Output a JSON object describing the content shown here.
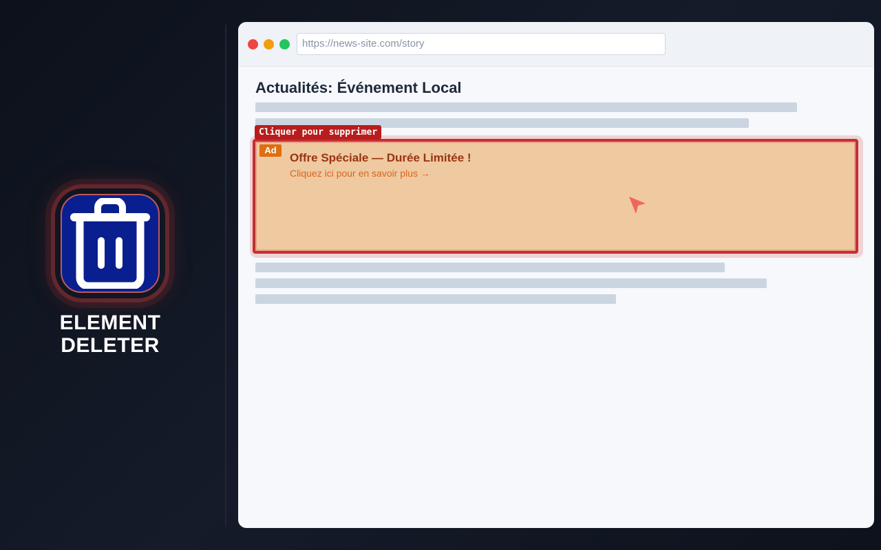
{
  "brand": {
    "name_line1": "ELEMENT",
    "name_line2": "DELETER",
    "icon": "trash-icon",
    "icon_bg_color": "#0a1f8f"
  },
  "browser": {
    "url": "https://news-site.com/story",
    "controls": [
      "close-dot",
      "minimize-dot",
      "maximize-dot"
    ]
  },
  "page": {
    "title": "Actualités: Événement Local"
  },
  "selector": {
    "tooltip": "Cliquer pour supprimer",
    "highlight_color": "#c43030"
  },
  "ad": {
    "badge": "Ad",
    "title": "Offre Spéciale — Durée Limitée !",
    "subtitle": "Cliquez ici pour en savoir plus →",
    "bg_color": "#efc9a0"
  },
  "cursor": {
    "icon": "pointer-cursor-icon",
    "color": "#f05a5a"
  }
}
